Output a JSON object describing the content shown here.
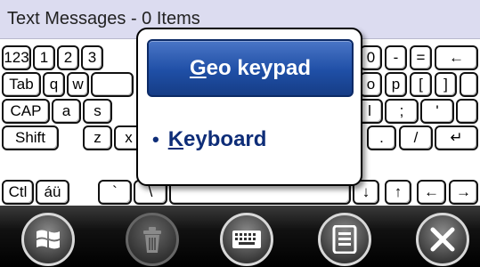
{
  "title_bar": {
    "text": "Text Messages - 0 Items"
  },
  "keyboard": {
    "row1": [
      "123",
      "1",
      "2",
      "3",
      "0",
      "-",
      "=",
      "←"
    ],
    "row2": [
      "Tab",
      "q",
      "w",
      "o",
      "p",
      "[",
      "]"
    ],
    "row3": [
      "CAP",
      "a",
      "s",
      "l",
      ";",
      "'"
    ],
    "row4": [
      "Shift",
      "z",
      "x",
      ".",
      "/",
      "↵"
    ],
    "row5": [
      "Ctl",
      "áü",
      "`",
      "\\",
      "↓",
      "↑",
      "←",
      "→"
    ]
  },
  "popup": {
    "selected": {
      "label": "Geo keypad",
      "underline_char": "G",
      "rest": "eo keypad"
    },
    "option": {
      "bullet": "•",
      "underline_char": "K",
      "rest": "eyboard"
    }
  },
  "taskbar": {
    "buttons": [
      {
        "name": "start",
        "icon": "windows-flag-icon",
        "enabled": true
      },
      {
        "name": "delete",
        "icon": "trash-icon",
        "enabled": false
      },
      {
        "name": "input-panel",
        "icon": "keyboard-icon",
        "enabled": true
      },
      {
        "name": "menu",
        "icon": "menu-icon",
        "enabled": true
      },
      {
        "name": "close",
        "icon": "close-icon",
        "enabled": true
      }
    ]
  },
  "colors": {
    "title_bg": "#dcdcf0",
    "popup_selected_bg": "#1f4fa6",
    "popup_option_text": "#0e2d78",
    "taskbar_bg": "#000000"
  }
}
